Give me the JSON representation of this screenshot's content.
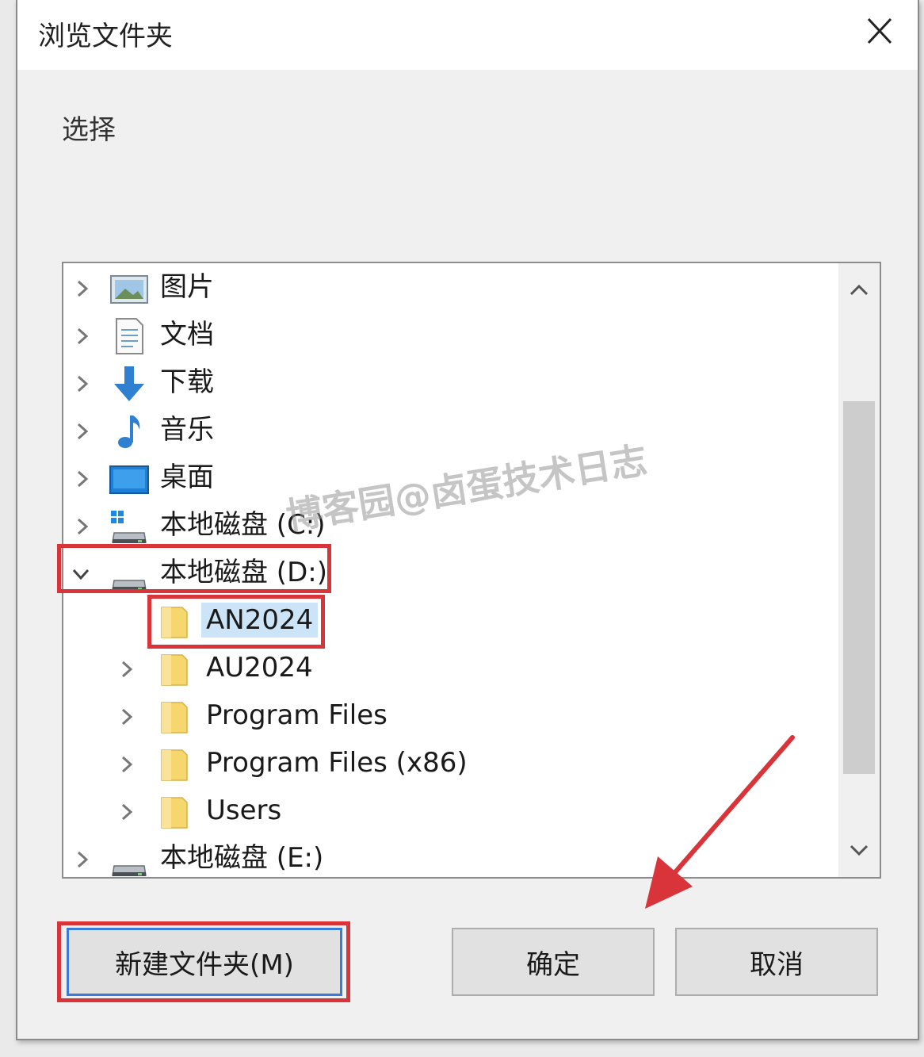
{
  "window": {
    "title": "浏览文件夹"
  },
  "prompt": "选择",
  "tree": {
    "items": [
      {
        "label": "图片",
        "icon": "pictures-icon"
      },
      {
        "label": "文档",
        "icon": "documents-icon"
      },
      {
        "label": "下载",
        "icon": "download-icon"
      },
      {
        "label": "音乐",
        "icon": "music-icon"
      },
      {
        "label": "桌面",
        "icon": "desktop-icon"
      },
      {
        "label": "本地磁盘 (C:)",
        "icon": "system-drive-icon"
      },
      {
        "label": "本地磁盘 (D:)",
        "icon": "drive-icon",
        "expanded": true
      },
      {
        "label": "AN2024",
        "icon": "folder-icon",
        "selected": true
      },
      {
        "label": "AU2024",
        "icon": "folder-icon"
      },
      {
        "label": "Program Files",
        "icon": "folder-icon"
      },
      {
        "label": "Program Files (x86)",
        "icon": "folder-icon"
      },
      {
        "label": "Users",
        "icon": "folder-icon"
      },
      {
        "label": "本地磁盘 (E:)",
        "icon": "drive-icon"
      }
    ]
  },
  "buttons": {
    "new_folder": "新建文件夹(M)",
    "ok": "确定",
    "cancel": "取消"
  },
  "watermark": "博客园@卤蛋技术日志",
  "colors": {
    "highlight": "#d9343a",
    "selection": "#cce4f7",
    "folder": "#f5d76e",
    "download_arrow": "#2f80d1"
  }
}
